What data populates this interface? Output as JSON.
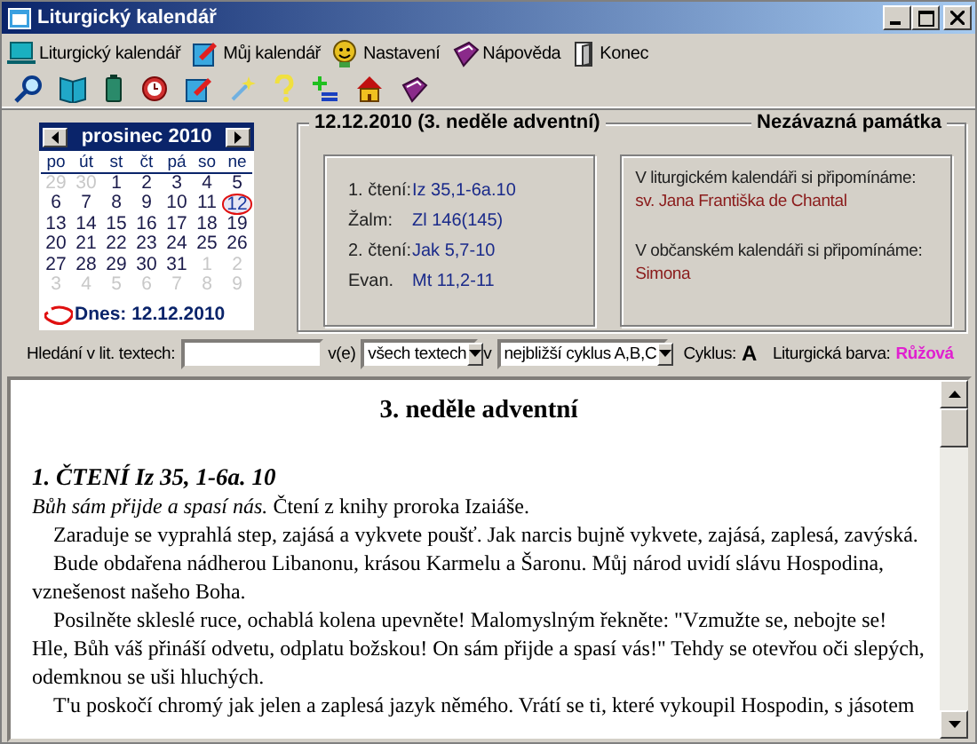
{
  "window": {
    "title": "Liturgický kalendář"
  },
  "menu": [
    {
      "label": "Liturgický kalendář"
    },
    {
      "label": "Můj kalendář"
    },
    {
      "label": "Nastavení"
    },
    {
      "label": "Nápověda"
    },
    {
      "label": "Konec"
    }
  ],
  "calendar": {
    "month": "prosinec 2010",
    "weekdays": [
      "po",
      "út",
      "st",
      "čt",
      "pá",
      "so",
      "ne"
    ],
    "weeks": [
      [
        {
          "day": "29",
          "other_month": true,
          "selected": false
        },
        {
          "day": "30",
          "other_month": true,
          "selected": false
        },
        {
          "day": "1",
          "other_month": false,
          "selected": false
        },
        {
          "day": "2",
          "other_month": false,
          "selected": false
        },
        {
          "day": "3",
          "other_month": false,
          "selected": false
        },
        {
          "day": "4",
          "other_month": false,
          "selected": false
        },
        {
          "day": "5",
          "other_month": false,
          "selected": false
        }
      ],
      [
        {
          "day": "6",
          "other_month": false,
          "selected": false
        },
        {
          "day": "7",
          "other_month": false,
          "selected": false
        },
        {
          "day": "8",
          "other_month": false,
          "selected": false
        },
        {
          "day": "9",
          "other_month": false,
          "selected": false
        },
        {
          "day": "10",
          "other_month": false,
          "selected": false
        },
        {
          "day": "11",
          "other_month": false,
          "selected": false
        },
        {
          "day": "12",
          "other_month": false,
          "selected": true
        }
      ],
      [
        {
          "day": "13",
          "other_month": false,
          "selected": false
        },
        {
          "day": "14",
          "other_month": false,
          "selected": false
        },
        {
          "day": "15",
          "other_month": false,
          "selected": false
        },
        {
          "day": "16",
          "other_month": false,
          "selected": false
        },
        {
          "day": "17",
          "other_month": false,
          "selected": false
        },
        {
          "day": "18",
          "other_month": false,
          "selected": false
        },
        {
          "day": "19",
          "other_month": false,
          "selected": false
        }
      ],
      [
        {
          "day": "20",
          "other_month": false,
          "selected": false
        },
        {
          "day": "21",
          "other_month": false,
          "selected": false
        },
        {
          "day": "22",
          "other_month": false,
          "selected": false
        },
        {
          "day": "23",
          "other_month": false,
          "selected": false
        },
        {
          "day": "24",
          "other_month": false,
          "selected": false
        },
        {
          "day": "25",
          "other_month": false,
          "selected": false
        },
        {
          "day": "26",
          "other_month": false,
          "selected": false
        }
      ],
      [
        {
          "day": "27",
          "other_month": false,
          "selected": false
        },
        {
          "day": "28",
          "other_month": false,
          "selected": false
        },
        {
          "day": "29",
          "other_month": false,
          "selected": false
        },
        {
          "day": "30",
          "other_month": false,
          "selected": false
        },
        {
          "day": "31",
          "other_month": false,
          "selected": false
        },
        {
          "day": "1",
          "other_month": true,
          "selected": false
        },
        {
          "day": "2",
          "other_month": true,
          "selected": false
        }
      ],
      [
        {
          "day": "3",
          "other_month": true,
          "selected": false
        },
        {
          "day": "4",
          "other_month": true,
          "selected": false
        },
        {
          "day": "5",
          "other_month": true,
          "selected": false
        },
        {
          "day": "6",
          "other_month": true,
          "selected": false
        },
        {
          "day": "7",
          "other_month": true,
          "selected": false
        },
        {
          "day": "8",
          "other_month": true,
          "selected": false
        },
        {
          "day": "9",
          "other_month": true,
          "selected": false
        }
      ]
    ],
    "today_label": "Dnes: 12.12.2010"
  },
  "day_panel": {
    "title": "12.12.2010 (3. neděle adventní)",
    "rank": "Nezávazná památka",
    "readings": [
      {
        "label": "1. čtení:",
        "ref": "Iz 35,1-6a.10"
      },
      {
        "label": "Žalm:",
        "ref": "Zl 146(145)"
      },
      {
        "label": "2. čtení:",
        "ref": "Jak 5,7-10"
      },
      {
        "label": "Evan.",
        "ref": "Mt 11,2-11"
      }
    ],
    "commemorations": [
      {
        "heading": "V liturgickém kalendáři si připomínáme:",
        "name": "sv. Jana Františka de Chantal"
      },
      {
        "heading": "V občanském kalendáři si připomínáme:",
        "name": "Simona"
      }
    ]
  },
  "search": {
    "label": "Hledání v lit. textech:",
    "in_label": "v(e)",
    "scope": "všech textech",
    "cycle_in_label": "v",
    "cycle_scope": "nejbližší cyklus A,B,C",
    "cycle_label": "Cyklus:",
    "cycle": "A",
    "color_label": "Liturgická barva:",
    "color_value": "Růžová"
  },
  "reading": {
    "heading": "3. neděle adventní",
    "title": "1. ČTENÍ Iz 35, 1-6a. 10",
    "summary": "*Bůh sám přijde a spasí nás.* Čtení z knihy proroka Izaiáše.",
    "paragraphs": [
      [
        "Zaraduje se vyprahlá step, zajásá a vykvete poušť. Jak narcis bujně vykvete, zajásá, zaplesá, zavýská."
      ],
      [
        "Bude obdařena nádherou Libanonu, krásou Karmelu a Šaronu. Můj národ uvidí slávu Hospodina, vznešenost našeho Boha."
      ],
      [
        "Posilněte skleslé ruce, ochablá kolena upevněte! Malomyslným řekněte: \"Vzmužte se, nebojte se!",
        "Hle, Bůh váš přináší odvetu, odplatu božskou! On sám přijde a spasí vás!\" Tehdy se otevřou oči slepých, odemknou se uši hluchých."
      ],
      [
        "T'u poskočí chromý jak jelen a zaplesá jazyk němého. Vrátí se ti, které vykoupil Hospodin, s jásotem"
      ]
    ]
  }
}
